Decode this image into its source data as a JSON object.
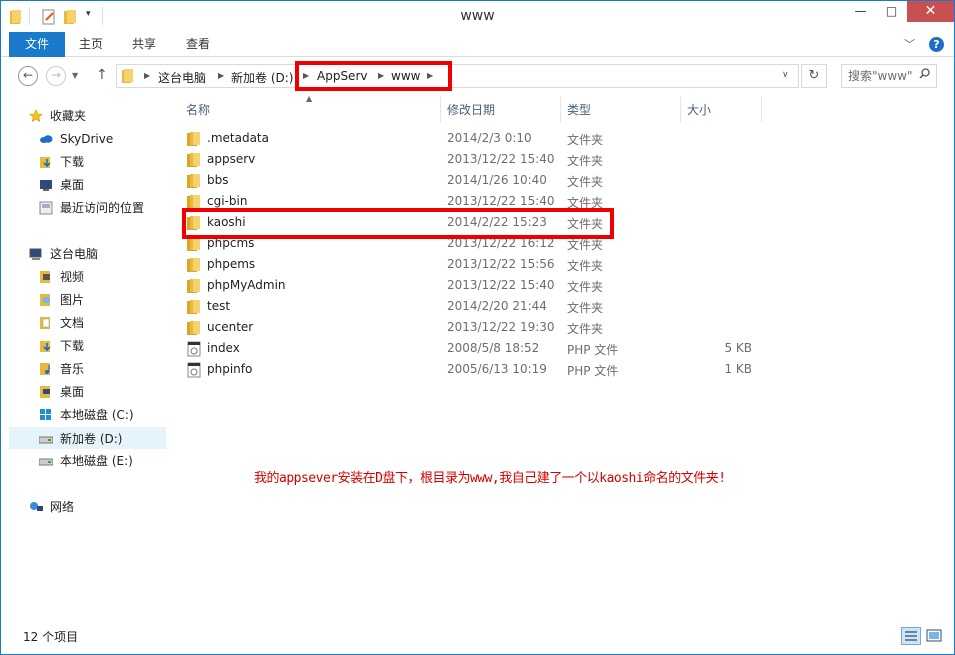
{
  "window": {
    "title": "www",
    "controls": {
      "minimize": "—",
      "maximize": "□",
      "close": "✕"
    }
  },
  "ribbon": {
    "tabs": [
      "文件",
      "主页",
      "共享",
      "查看"
    ],
    "help": "?"
  },
  "address": {
    "crumbs": [
      "这台电脑",
      "新加卷 (D:)",
      "AppServ",
      "www"
    ],
    "search_placeholder": "搜索\"www\""
  },
  "nav": {
    "favorites_header": "收藏夹",
    "favorites": [
      "SkyDrive",
      "下载",
      "桌面",
      "最近访问的位置"
    ],
    "computer_header": "这台电脑",
    "computer": [
      "视频",
      "图片",
      "文档",
      "下载",
      "音乐",
      "桌面",
      "本地磁盘 (C:)",
      "新加卷 (D:)",
      "本地磁盘 (E:)"
    ],
    "network": "网络",
    "selected": "新加卷 (D:)"
  },
  "columns": [
    "名称",
    "修改日期",
    "类型",
    "大小"
  ],
  "files": [
    {
      "name": ".metadata",
      "date": "2014/2/3 0:10",
      "type": "文件夹",
      "size": "",
      "kind": "folder"
    },
    {
      "name": "appserv",
      "date": "2013/12/22 15:40",
      "type": "文件夹",
      "size": "",
      "kind": "folder"
    },
    {
      "name": "bbs",
      "date": "2014/1/26 10:40",
      "type": "文件夹",
      "size": "",
      "kind": "folder"
    },
    {
      "name": "cgi-bin",
      "date": "2013/12/22 15:40",
      "type": "文件夹",
      "size": "",
      "kind": "folder"
    },
    {
      "name": "kaoshi",
      "date": "2014/2/22 15:23",
      "type": "文件夹",
      "size": "",
      "kind": "folder"
    },
    {
      "name": "phpcms",
      "date": "2013/12/22 16:12",
      "type": "文件夹",
      "size": "",
      "kind": "folder"
    },
    {
      "name": "phpems",
      "date": "2013/12/22 15:56",
      "type": "文件夹",
      "size": "",
      "kind": "folder"
    },
    {
      "name": "phpMyAdmin",
      "date": "2013/12/22 15:40",
      "type": "文件夹",
      "size": "",
      "kind": "folder"
    },
    {
      "name": "test",
      "date": "2014/2/20 21:44",
      "type": "文件夹",
      "size": "",
      "kind": "folder"
    },
    {
      "name": "ucenter",
      "date": "2013/12/22 19:30",
      "type": "文件夹",
      "size": "",
      "kind": "folder"
    },
    {
      "name": "index",
      "date": "2008/5/8 18:52",
      "type": "PHP 文件",
      "size": "5 KB",
      "kind": "php"
    },
    {
      "name": "phpinfo",
      "date": "2005/6/13 10:19",
      "type": "PHP 文件",
      "size": "1 KB",
      "kind": "php"
    }
  ],
  "annotation": "我的appsever安装在D盘下，根目录为www,我自己建了一个以kaoshi命名的文件夹!",
  "status": {
    "item_count": "12 个项目"
  },
  "colors": {
    "accent": "#1979ca",
    "highlight": "#ee0000",
    "annotation": "#d40000",
    "close": "#c75050"
  }
}
